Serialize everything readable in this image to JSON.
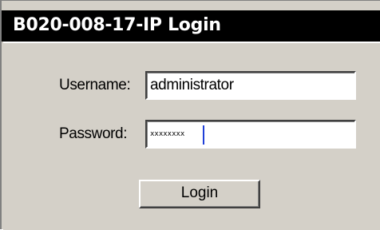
{
  "window": {
    "title": "B020-008-17-IP Login"
  },
  "form": {
    "username_label": "Username:",
    "username_value": "administrator",
    "password_label": "Password:",
    "password_value": "xxxxxxxx",
    "login_label": "Login"
  },
  "colors": {
    "titlebar": "#000000",
    "title_text": "#ffffff",
    "panel": "#d4d0c8",
    "caret": "#1f3fd8"
  }
}
